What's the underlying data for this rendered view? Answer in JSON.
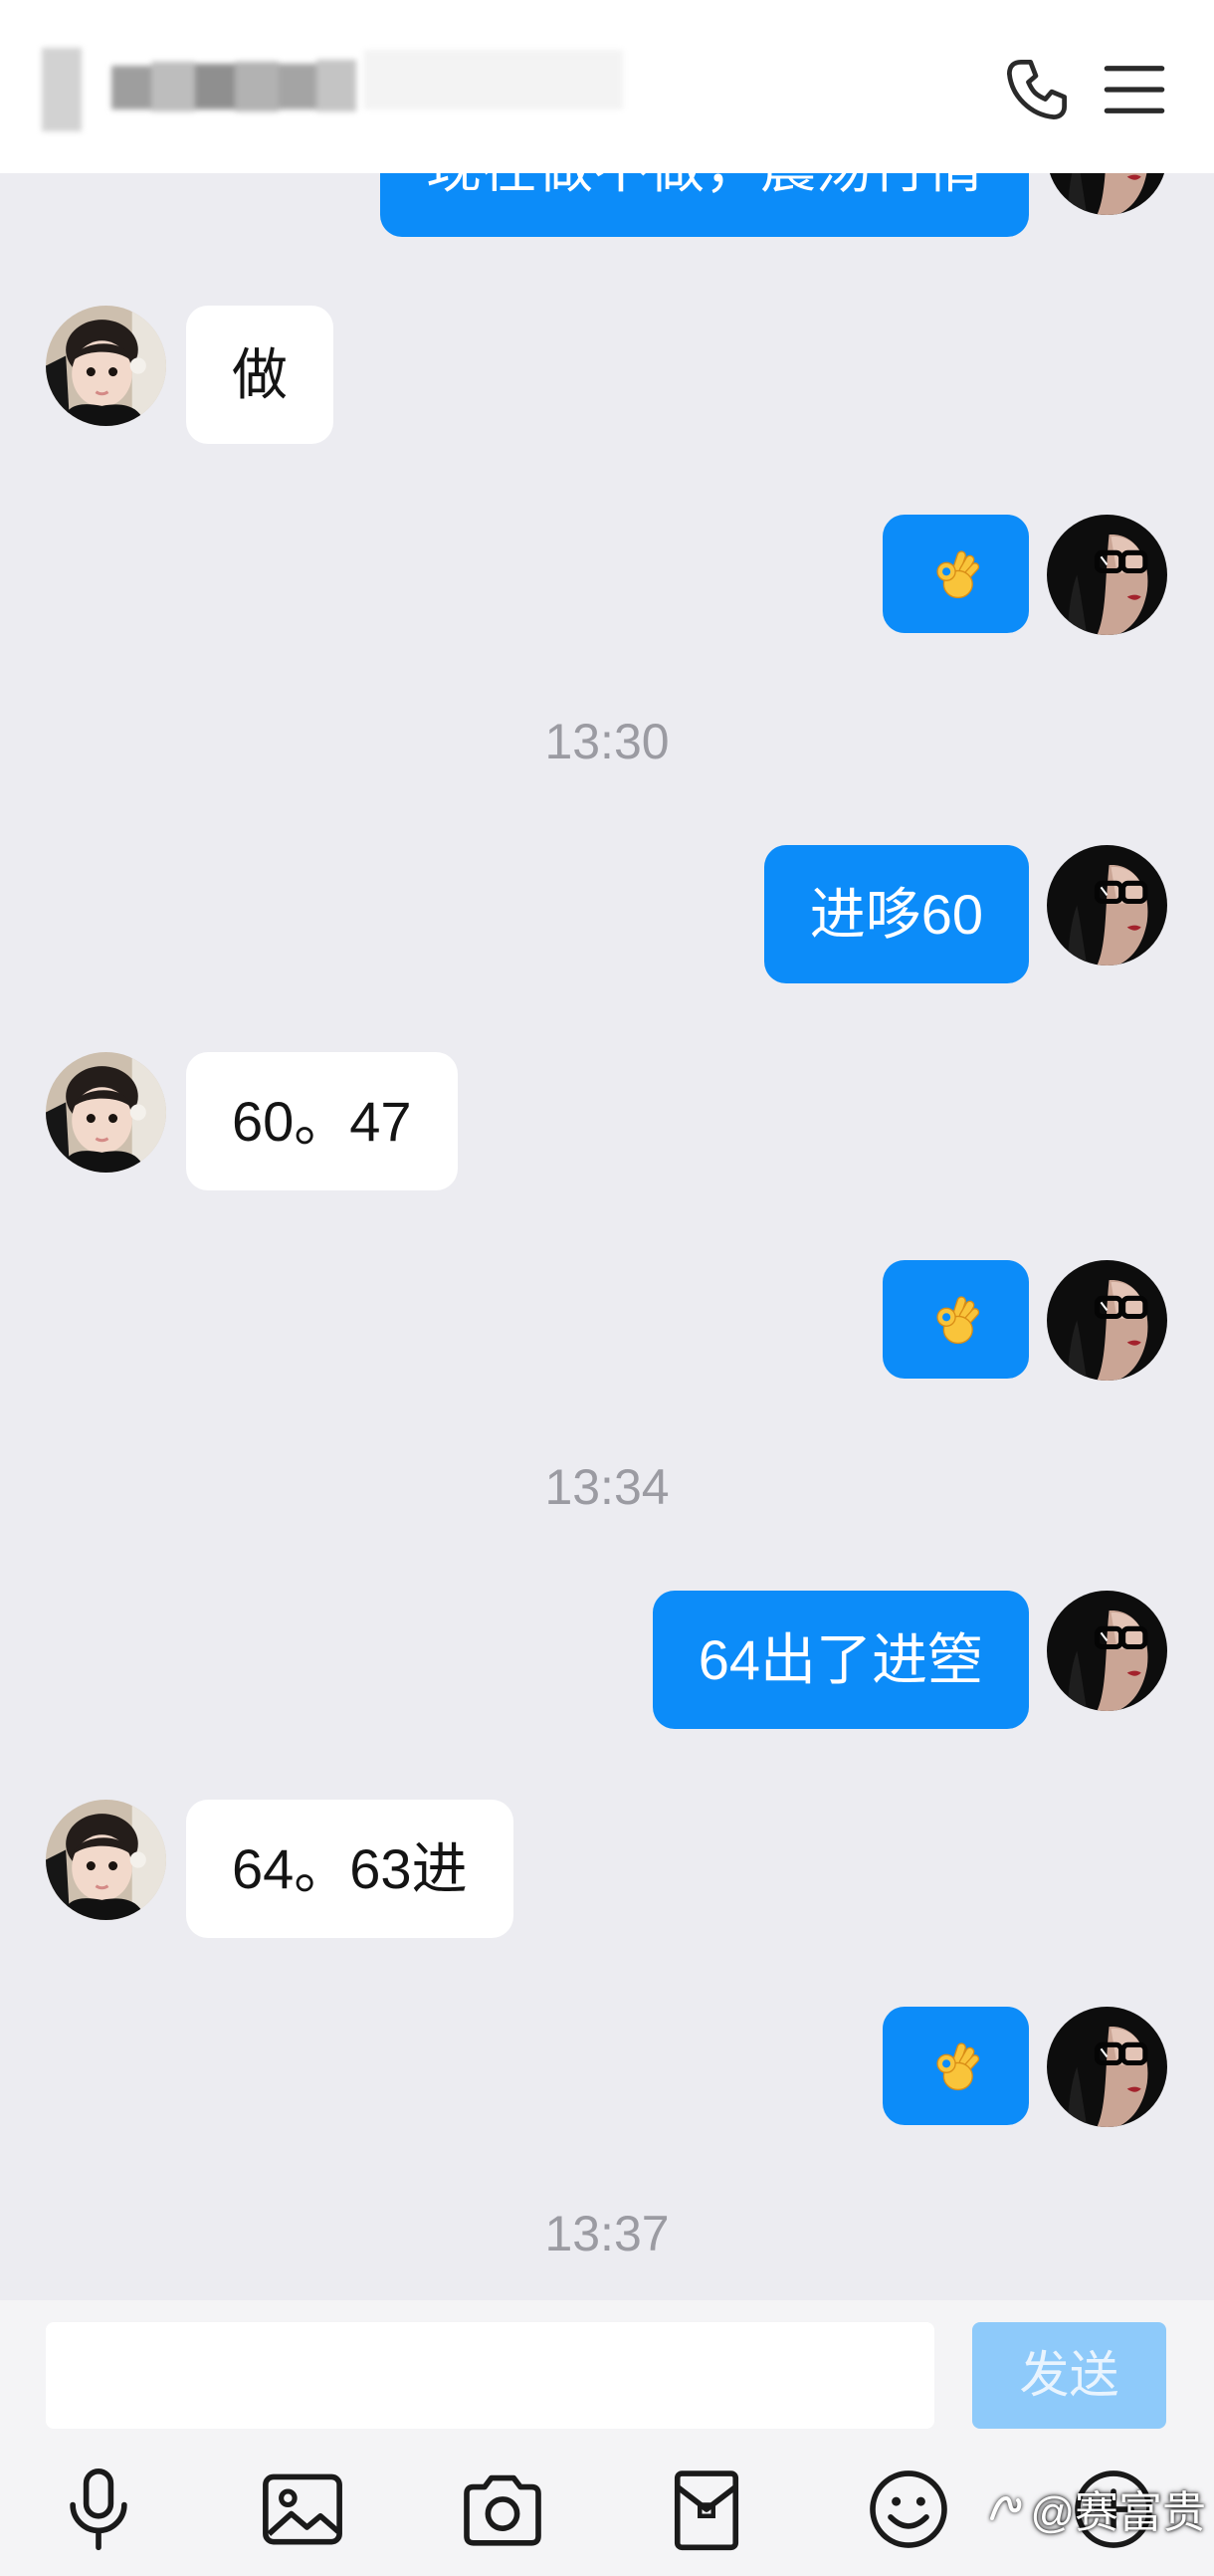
{
  "header": {
    "contact_name_blurred": true,
    "icons": [
      "phone-icon",
      "menu-icon"
    ]
  },
  "messages": [
    {
      "side": "out",
      "kind": "text",
      "text": "现在做不做，震荡行情"
    },
    {
      "side": "in",
      "kind": "text",
      "text": "做"
    },
    {
      "side": "out",
      "kind": "emoji",
      "icon": "ok-hand-emoji"
    },
    {
      "kind": "time",
      "text": "13:30"
    },
    {
      "side": "out",
      "kind": "text",
      "text": "进哆60"
    },
    {
      "side": "in",
      "kind": "text",
      "text": "60。47"
    },
    {
      "side": "out",
      "kind": "emoji",
      "icon": "ok-hand-emoji"
    },
    {
      "kind": "time",
      "text": "13:34"
    },
    {
      "side": "out",
      "kind": "text",
      "text": "64出了进箜"
    },
    {
      "side": "in",
      "kind": "text",
      "text": "64。63进"
    },
    {
      "side": "out",
      "kind": "emoji",
      "icon": "ok-hand-emoji"
    },
    {
      "kind": "time",
      "text": "13:37"
    }
  ],
  "composer": {
    "input_value": "",
    "send_label": "发送"
  },
  "toolbar": {
    "icons": [
      "microphone-icon",
      "image-icon",
      "camera-icon",
      "red-packet-icon",
      "emoji-icon",
      "plus-icon"
    ]
  },
  "watermark": {
    "logo": "zhihu-logo-icon",
    "text": "@赛富贵"
  },
  "colors": {
    "outgoing_bubble": "#0c8cf9",
    "incoming_bubble": "#ffffff",
    "chat_background": "#ececf1",
    "send_button": "#8ecafa",
    "timestamp": "#9b9ba2"
  }
}
